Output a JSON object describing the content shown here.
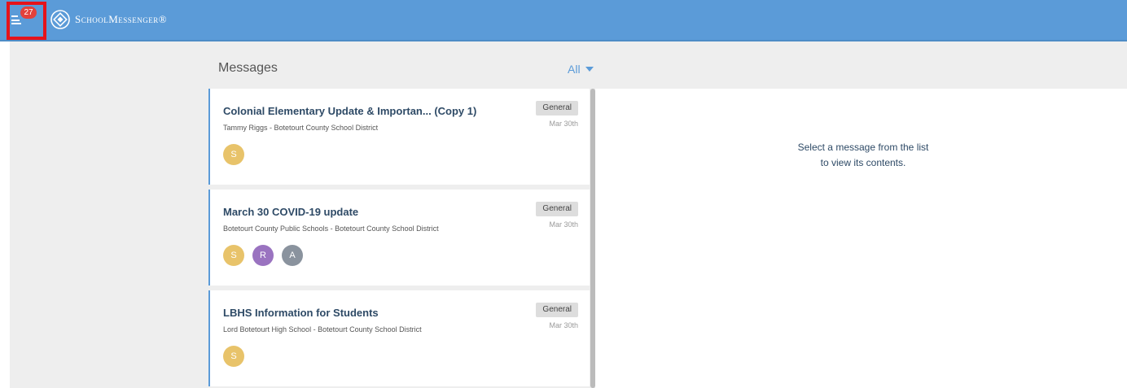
{
  "header": {
    "notification_count": "27",
    "logo_text": "SchoolMessenger®"
  },
  "list": {
    "title": "Messages",
    "filter_label": "All"
  },
  "messages": [
    {
      "title": "Colonial Elementary Update & Importan... (Copy 1)",
      "sender": "Tammy Riggs - Botetourt County School District",
      "tag": "General",
      "date": "Mar 30th",
      "avatars": [
        {
          "letter": "S",
          "color": "#e8c36a"
        }
      ]
    },
    {
      "title": "March 30 COVID-19 update",
      "sender": "Botetourt County Public Schools - Botetourt County School District",
      "tag": "General",
      "date": "Mar 30th",
      "avatars": [
        {
          "letter": "S",
          "color": "#e8c36a"
        },
        {
          "letter": "R",
          "color": "#9a73c0"
        },
        {
          "letter": "A",
          "color": "#8a939e"
        }
      ]
    },
    {
      "title": "LBHS Information for Students",
      "sender": "Lord Botetourt High School - Botetourt County School District",
      "tag": "General",
      "date": "Mar 30th",
      "avatars": [
        {
          "letter": "S",
          "color": "#e8c36a"
        }
      ]
    }
  ],
  "detail": {
    "empty_line1": "Select a message from the list",
    "empty_line2": "to view its contents."
  }
}
